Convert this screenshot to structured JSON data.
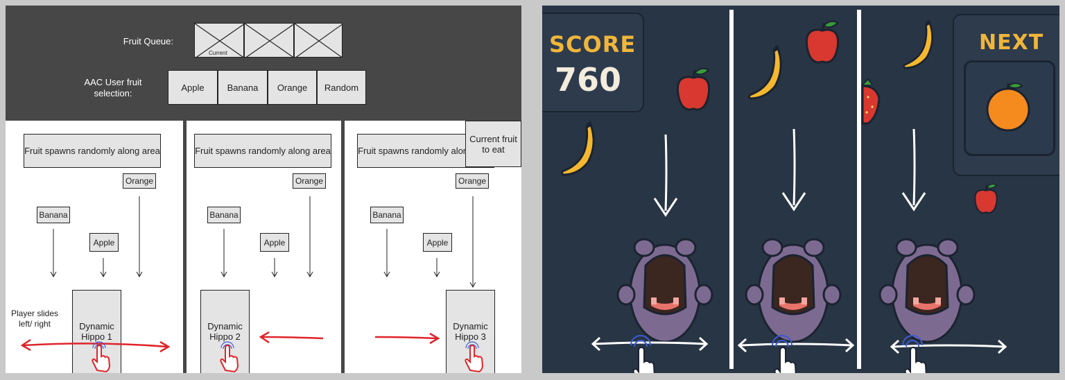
{
  "wireframe": {
    "queue_label": "Fruit Queue:",
    "queue_current": "Current",
    "selection_label": "AAC User fruit\nselection:",
    "selection_buttons": [
      "Apple",
      "Banana",
      "Orange",
      "Random"
    ],
    "spawn_text": "Fruit spawns randomly along area",
    "current_fruit_box": "Current fruit to eat",
    "player_note": "Player slides left/ right",
    "fruit_tags": {
      "banana": "Banana",
      "apple": "Apple",
      "orange": "Orange"
    },
    "hippos": [
      "Dynamic Hippo 1",
      "Dynamic Hippo 2",
      "Dynamic Hippo 3"
    ]
  },
  "game": {
    "score_label": "SCORE",
    "score_value": "760",
    "next_label": "NEXT",
    "next_fruit_icon": "orange-icon"
  },
  "colors": {
    "wire_header": "#474747",
    "game_bg": "#283544",
    "score_accent": "#f0b53a",
    "arrow_red": "#e0232a",
    "hippo_purple": "#7d6a91"
  }
}
